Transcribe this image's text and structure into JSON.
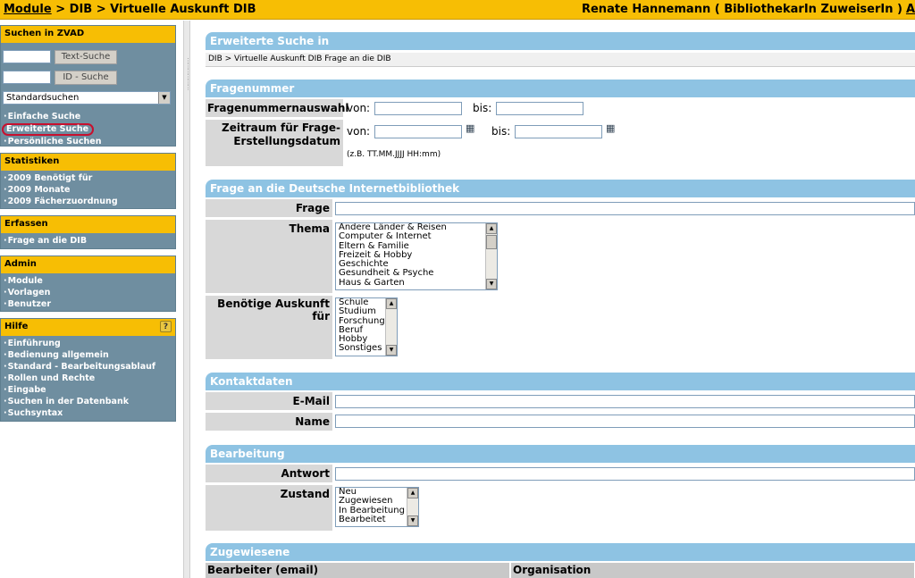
{
  "topbar": {
    "module_link": "Module",
    "crumb_rest": " > DIB > Virtuelle Auskunft DIB",
    "user": "Renate Hannemann ( BibliothekarIn ZuweiserIn )",
    "user_link": "A"
  },
  "sidebar": {
    "search": {
      "title": "Suchen in ZVAD",
      "text_search_button": "Text-Suche",
      "id_search_button": "ID - Suche",
      "select_value": "Standardsuchen",
      "links": [
        "Einfache Suche",
        "Erweiterte Suche",
        "Persönliche Suchen"
      ]
    },
    "stats": {
      "title": "Statistiken",
      "links": [
        "2009 Benötigt für",
        "2009 Monate",
        "2009 Fächerzuordnung"
      ]
    },
    "capture": {
      "title": "Erfassen",
      "links": [
        "Frage an die DIB"
      ]
    },
    "admin": {
      "title": "Admin",
      "links": [
        "Module",
        "Vorlagen",
        "Benutzer"
      ]
    },
    "help": {
      "title": "Hilfe",
      "help_icon": "?",
      "links": [
        "Einführung",
        "Bedienung allgemein",
        "Standard - Bearbeitungsablauf",
        "Rollen und Rechte",
        "Eingabe",
        "Suchen in der Datenbank",
        "Suchsyntax"
      ]
    }
  },
  "main": {
    "erweiterte": {
      "title": "Erweiterte Suche in",
      "path": "DIB > Virtuelle Auskunft DIB Frage an die DIB"
    },
    "fragenummer": {
      "title": "Fragenummer",
      "auswahl_label": "Fragenummernauswahl",
      "von": "von:",
      "bis": "bis:",
      "zeitraum_label_1": "Zeitraum für Frage-",
      "zeitraum_label_2": "Erstellungsdatum",
      "hint": "(z.B. TT.MM.JJJJ HH:mm)"
    },
    "frage": {
      "title": "Frage an die Deutsche Internetbibliothek",
      "frage_label": "Frage",
      "thema_label": "Thema",
      "thema_options": [
        "Andere Länder & Reisen",
        "Computer & Internet",
        "Eltern & Familie",
        "Freizeit & Hobby",
        "Geschichte",
        "Gesundheit & Psyche",
        "Haus & Garten"
      ],
      "auskunft_label_1": "Benötige Auskunft",
      "auskunft_label_2": "für",
      "auskunft_options": [
        "Schule",
        "Studium",
        "Forschung",
        "Beruf",
        "Hobby",
        "Sonstiges"
      ]
    },
    "kontakt": {
      "title": "Kontaktdaten",
      "email_label": "E-Mail",
      "name_label": "Name"
    },
    "bearbeitung": {
      "title": "Bearbeitung",
      "antwort_label": "Antwort",
      "zustand_label": "Zustand",
      "zustand_options": [
        "Neu",
        "Zugewiesen",
        "In Bearbeitung",
        "Bearbeitet"
      ]
    },
    "zugewiesene": {
      "title": "Zugewiesene",
      "col1": "Bearbeiter (email)",
      "col2": "Organisation"
    }
  }
}
